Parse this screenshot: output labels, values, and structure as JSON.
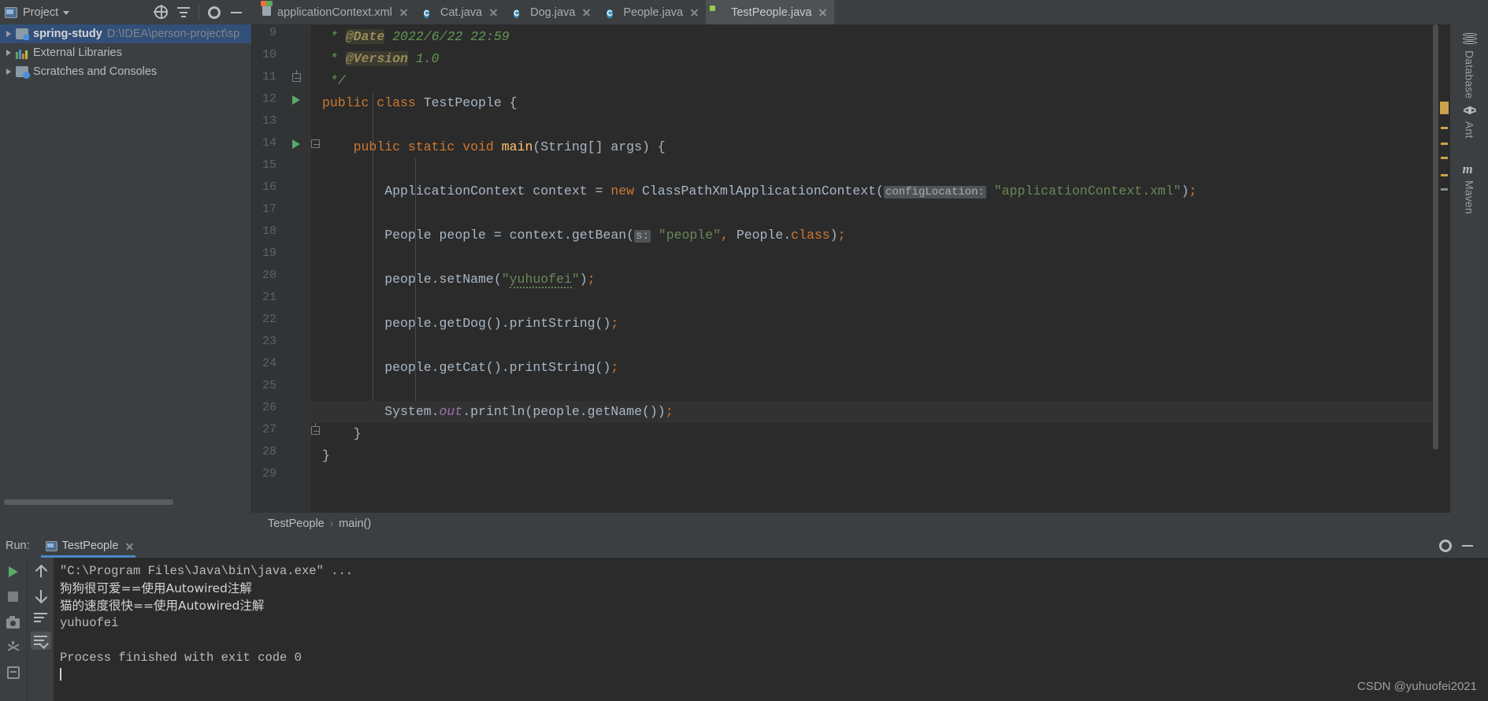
{
  "project_toolbar": {
    "title": "Project",
    "icons": [
      "project-icon",
      "chevron-down-icon",
      "locate-icon",
      "collapse-all-icon",
      "gear-icon",
      "minimize-icon"
    ]
  },
  "tabs": [
    {
      "label": "applicationContext.xml",
      "icon": "xml-file-icon",
      "active": false
    },
    {
      "label": "Cat.java",
      "icon": "java-class-icon",
      "active": false
    },
    {
      "label": "Dog.java",
      "icon": "java-class-icon",
      "active": false
    },
    {
      "label": "People.java",
      "icon": "java-class-icon",
      "active": false
    },
    {
      "label": "TestPeople.java",
      "icon": "spring-java-class-icon",
      "active": true
    }
  ],
  "project_tree": [
    {
      "name": "spring-study",
      "path": "D:\\IDEA\\person-project\\sp",
      "icon": "module-folder-icon",
      "selected": true
    },
    {
      "name": "External Libraries",
      "path": "",
      "icon": "libraries-icon",
      "selected": false
    },
    {
      "name": "Scratches and Consoles",
      "path": "",
      "icon": "scratches-icon",
      "selected": false
    }
  ],
  "editor": {
    "first_line": 9,
    "lines": [
      {
        "n": 9,
        "text": " * @Date 2022/6/22 22:59"
      },
      {
        "n": 10,
        "text": " * @Version 1.0"
      },
      {
        "n": 11,
        "text": " */"
      },
      {
        "n": 12,
        "text": "public class TestPeople {"
      },
      {
        "n": 13,
        "text": ""
      },
      {
        "n": 14,
        "text": "    public static void main(String[] args) {"
      },
      {
        "n": 15,
        "text": ""
      },
      {
        "n": 16,
        "text": "        ApplicationContext context = new ClassPathXmlApplicationContext( configLocation: \"applicationContext.xml\");"
      },
      {
        "n": 17,
        "text": ""
      },
      {
        "n": 18,
        "text": "        People people = context.getBean( s: \"people\", People.class);"
      },
      {
        "n": 19,
        "text": ""
      },
      {
        "n": 20,
        "text": "        people.setName(\"yuhuofei\");"
      },
      {
        "n": 21,
        "text": ""
      },
      {
        "n": 22,
        "text": "        people.getDog().printString();"
      },
      {
        "n": 23,
        "text": ""
      },
      {
        "n": 24,
        "text": "        people.getCat().printString();"
      },
      {
        "n": 25,
        "text": ""
      },
      {
        "n": 26,
        "text": "        System.out.println(people.getName());"
      },
      {
        "n": 27,
        "text": "    }"
      },
      {
        "n": 28,
        "text": "}"
      },
      {
        "n": 29,
        "text": ""
      }
    ],
    "param_hints": {
      "config_location": "configLocation:",
      "bean_name": "s:"
    },
    "highlighted_line": 26
  },
  "breadcrumb": {
    "class": "TestPeople",
    "separator": "›",
    "method": "main()"
  },
  "right_tool_window": [
    {
      "label": "Database",
      "icon": "database-icon"
    },
    {
      "label": "Ant",
      "icon": "ant-icon"
    },
    {
      "label": "Maven",
      "icon": "maven-icon"
    }
  ],
  "run_panel": {
    "label": "Run:",
    "tab": "TestPeople",
    "tab_icon": "run-configuration-icon",
    "header_icons": [
      "gear-icon",
      "minimize-icon"
    ],
    "toolbar_left": [
      "rerun-icon",
      "stop-icon",
      "screenshot-icon",
      "thread-dump-icon",
      "exit-icon",
      "trash-icon"
    ],
    "toolbar_right": [
      "scroll-up-icon",
      "scroll-down-icon",
      "soft-wrap-icon",
      "scroll-to-end-icon",
      "print-icon",
      "clear-all-icon"
    ],
    "console": [
      {
        "text": "\"C:\\Program Files\\Java\\bin\\java.exe\" ...",
        "style": "cmd"
      },
      {
        "text": "狗狗很可爱==使用Autowired注解",
        "style": "cjk"
      },
      {
        "text": "猫的速度很快==使用Autowired注解",
        "style": "cjk"
      },
      {
        "text": "yuhuofei",
        "style": "plain"
      },
      {
        "text": "",
        "style": "plain"
      },
      {
        "text": "Process finished with exit code 0",
        "style": "plain"
      }
    ]
  },
  "watermark": "CSDN @yuhuofei2021",
  "colors": {
    "bg_chrome": "#3c3f41",
    "bg_editor": "#2b2b2b",
    "accent_blue": "#4a88c7",
    "keyword_orange": "#cc7832",
    "string_green": "#6a8759",
    "comment_green": "#629755",
    "selection_blue": "#314f78"
  }
}
